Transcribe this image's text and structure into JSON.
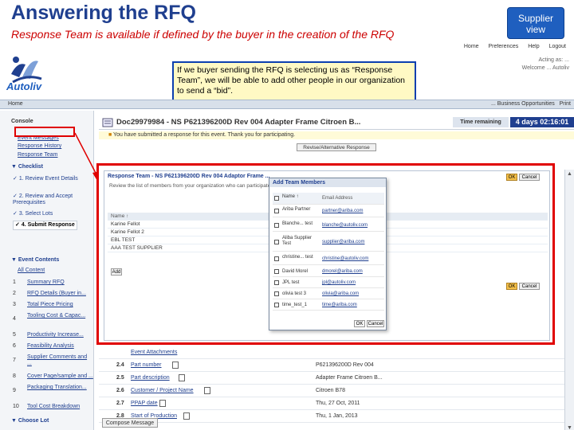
{
  "slide": {
    "title": "Answering the RFQ",
    "subtitle": "Response Team  is available if defined by the buyer in the creation of the RFQ",
    "supplier_view": "Supplier view",
    "callout": "If we buyer sending the RFQ is selecting us as “Response Team”, we will be able to add other people in our organization to send a “bid”."
  },
  "colors": {
    "title": "#1f3f8f",
    "subtitle": "#cc0000",
    "highlight": "#e00000",
    "supplier_box": "#1f5fbf",
    "callout_bg": "#fff9c4"
  },
  "app": {
    "top_nav": [
      "Home",
      "Preferences",
      "Help",
      "Logout"
    ],
    "logo": "Autoliv",
    "user_line1": "Acting as: ...",
    "user_line2": "Welcome ... Autoliv",
    "navbar_home": "Home",
    "navbar_right": "... Business Opportunities",
    "print": "Print",
    "console": "Console",
    "console_links": [
      "Event Messages",
      "Response History",
      "Response Team"
    ],
    "checklist_title": "Checklist",
    "checklist": [
      {
        "label": "1. Review Event Details"
      },
      {
        "label": "2. Review and Accept Prerequisites"
      },
      {
        "label": "3. Select Lots"
      },
      {
        "label": "4. Submit Response"
      }
    ],
    "event_contents_title": "Event Contents",
    "event_contents_all": "All Content",
    "event_contents": [
      {
        "num": "1",
        "label": "Summary RFQ"
      },
      {
        "num": "2",
        "label": "RFQ Details (Buyer in..."
      },
      {
        "num": "3",
        "label": "Total Piece Pricing"
      },
      {
        "num": "4",
        "label": "Tooling Cost & Capac..."
      },
      {
        "num": "5",
        "label": "Productivity Increase..."
      },
      {
        "num": "6",
        "label": "Feasibility Analysis"
      },
      {
        "num": "7",
        "label": "Supplier Comments and ..."
      },
      {
        "num": "8",
        "label": "Cover Page/sample and ..."
      },
      {
        "num": "9",
        "label": "Packaging Translation..."
      },
      {
        "num": "10",
        "label": "Tool Cost Breakdown"
      }
    ],
    "choose_lot": "Choose Lot",
    "doc_title": "Doc29979984 - NS P621396200D Rev 004 Adapter Frame Citroen B...",
    "time_remaining_label": "Time remaining",
    "time_remaining_value": "4 days 02:16:01",
    "notice": "You have submitted a response for this event. Thank you for participating.",
    "revise_button": "Revise/Alternative Response",
    "response_team_title": "Response Team - NS P621396200D Rev 004 Adaptor Frame ...",
    "response_team_desc": "Review the list of members from your organization who can participate ...",
    "ok": "OK",
    "cancel": "Cancel",
    "add": "Add",
    "team_table": {
      "header": "Name ↑",
      "rows": [
        "Karine Fellot",
        "Karine Fellot 2",
        "EBL TEST",
        "AAA TEST SUPPLIER"
      ]
    },
    "modal": {
      "title": "Add Team Members",
      "headers": {
        "name": "Name ↑",
        "email": "Email Address"
      },
      "rows": [
        {
          "name": "Ariba Partner",
          "email": "partner@ariba.com"
        },
        {
          "name": "Blanche... test",
          "email": "blanche@autoliv.com"
        },
        {
          "name": "Aliba Supplier Test",
          "email": "supplier@ariba.com"
        },
        {
          "name": "christine... test",
          "email": "christine@autoliv.com"
        },
        {
          "name": "David Morel",
          "email": "dmorel@ariba.com"
        },
        {
          "name": "JPL test",
          "email": "jpl@autoliv.com"
        },
        {
          "name": "olivia test 3",
          "email": "olivia@ariba.com"
        },
        {
          "name": "time_test_1",
          "email": "time@ariba.com"
        }
      ],
      "ok": "OK",
      "cancel": "Cancel"
    },
    "lower_rows": [
      {
        "num": "",
        "name": "Event Attachments",
        "value": ""
      },
      {
        "num": "2.4",
        "name": "Part number",
        "value": "P621396200D Rev 004"
      },
      {
        "num": "2.5",
        "name": "Part description",
        "value": "Adapter Frame Citroen B..."
      },
      {
        "num": "2.6",
        "name": "Customer / Project Name",
        "value": "Citroen B78"
      },
      {
        "num": "2.7",
        "name": "PPAP date",
        "value": "Thu, 27 Oct, 2011"
      },
      {
        "num": "2.8",
        "name": "Start of Production",
        "value": "Thu, 1 Jan, 2013"
      }
    ],
    "compose_message": "Compose Message"
  }
}
